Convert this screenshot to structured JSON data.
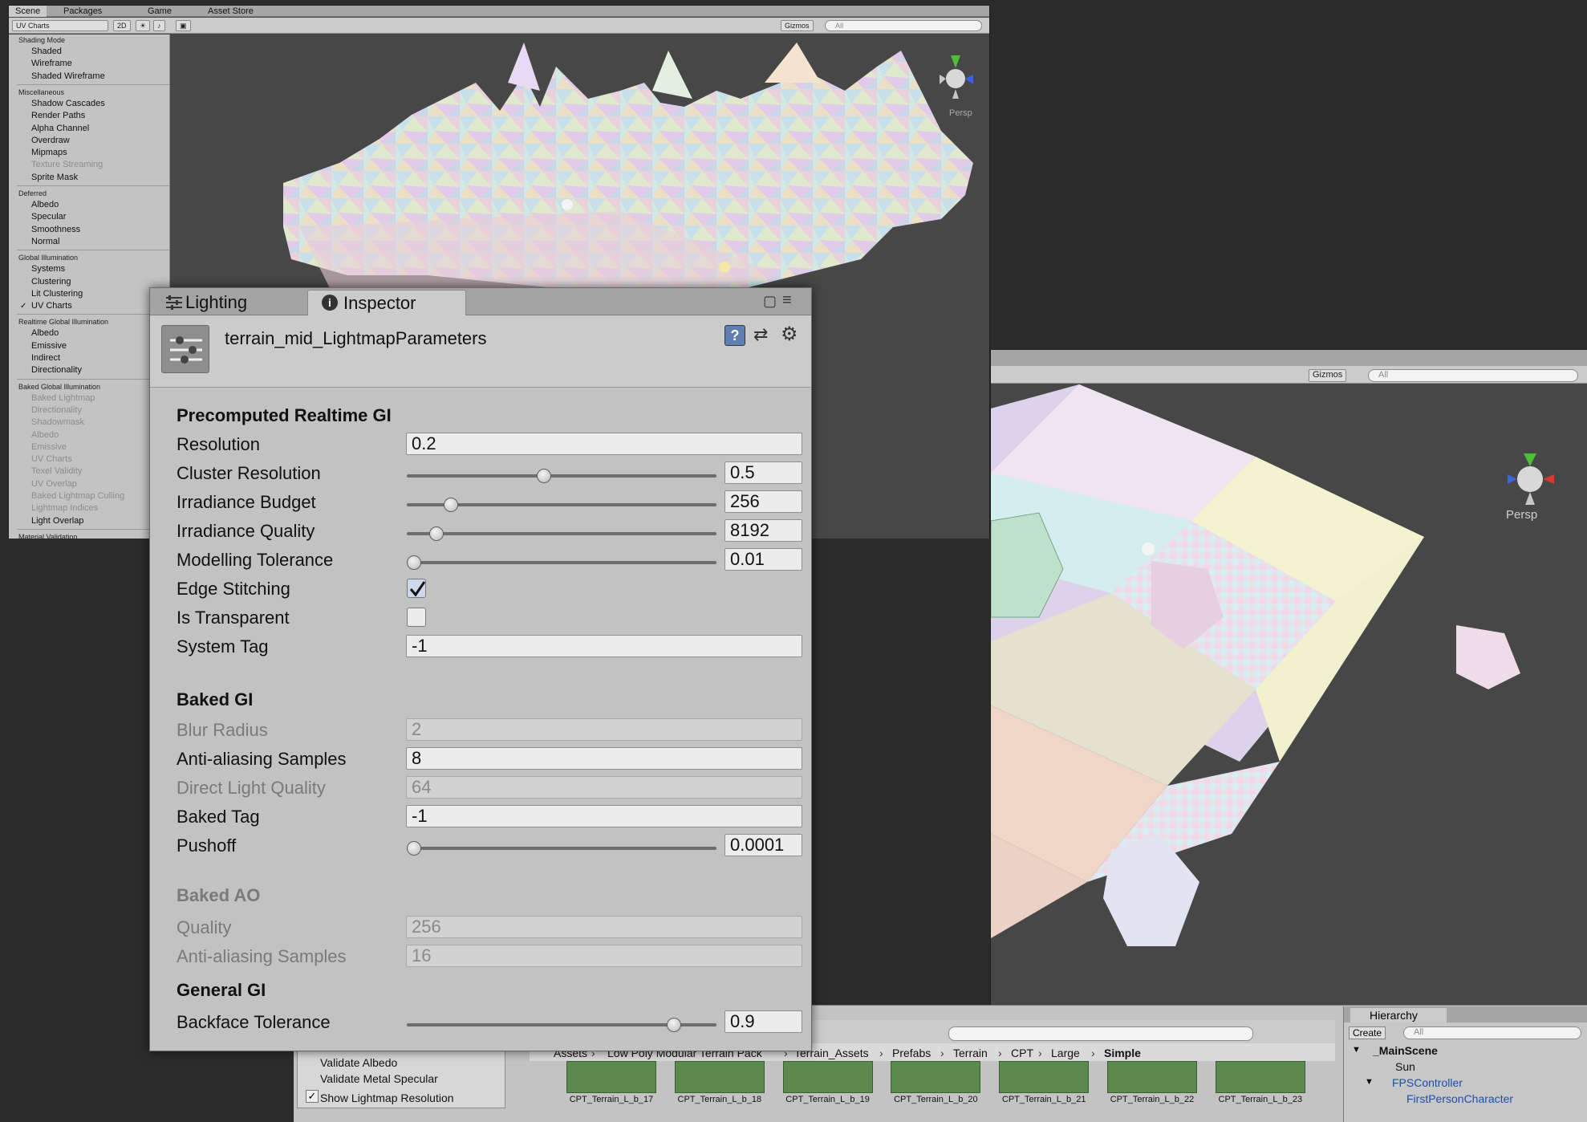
{
  "scene_window": {
    "tabs": [
      "Scene",
      "Packages",
      "Game",
      "Asset Store"
    ],
    "draw_mode": "UV Charts",
    "toolbar_2d": "2D",
    "gizmos": "Gizmos",
    "search_placeholder": "All",
    "persp": "Persp",
    "axes": [
      "y",
      "z",
      "x"
    ]
  },
  "view_menu": {
    "sections": [
      {
        "header": "Shading Mode",
        "items": [
          {
            "label": "Shaded",
            "dim": false
          },
          {
            "label": "Wireframe",
            "dim": false
          },
          {
            "label": "Shaded Wireframe",
            "dim": false
          }
        ]
      },
      {
        "header": "Miscellaneous",
        "items": [
          {
            "label": "Shadow Cascades",
            "dim": false
          },
          {
            "label": "Render Paths",
            "dim": false
          },
          {
            "label": "Alpha Channel",
            "dim": false
          },
          {
            "label": "Overdraw",
            "dim": false
          },
          {
            "label": "Mipmaps",
            "dim": false
          },
          {
            "label": "Texture Streaming",
            "dim": true
          },
          {
            "label": "Sprite Mask",
            "dim": false
          }
        ]
      },
      {
        "header": "Deferred",
        "items": [
          {
            "label": "Albedo",
            "dim": false
          },
          {
            "label": "Specular",
            "dim": false
          },
          {
            "label": "Smoothness",
            "dim": false
          },
          {
            "label": "Normal",
            "dim": false
          }
        ]
      },
      {
        "header": "Global Illumination",
        "items": [
          {
            "label": "Systems",
            "dim": false
          },
          {
            "label": "Clustering",
            "dim": false
          },
          {
            "label": "Lit Clustering",
            "dim": false
          },
          {
            "label": "UV Charts",
            "dim": false,
            "checked": true
          }
        ]
      },
      {
        "header": "Realtime Global Illumination",
        "items": [
          {
            "label": "Albedo",
            "dim": false
          },
          {
            "label": "Emissive",
            "dim": false
          },
          {
            "label": "Indirect",
            "dim": false
          },
          {
            "label": "Directionality",
            "dim": false
          }
        ]
      },
      {
        "header": "Baked Global Illumination",
        "items": [
          {
            "label": "Baked Lightmap",
            "dim": true
          },
          {
            "label": "Directionality",
            "dim": true
          },
          {
            "label": "Shadowmask",
            "dim": true
          },
          {
            "label": "Albedo",
            "dim": true
          },
          {
            "label": "Emissive",
            "dim": true
          },
          {
            "label": "UV Charts",
            "dim": true
          },
          {
            "label": "Texel Validity",
            "dim": true
          },
          {
            "label": "UV Overlap",
            "dim": true
          },
          {
            "label": "Baked Lightmap Culling",
            "dim": true
          },
          {
            "label": "Lightmap Indices",
            "dim": true
          },
          {
            "label": "Light Overlap",
            "dim": false
          }
        ]
      },
      {
        "header": "Material Validation",
        "items": []
      }
    ],
    "bottom_items": [
      "Validate Albedo",
      "Validate Metal Specular",
      "Show Lightmap Resolution"
    ]
  },
  "scene_window2": {
    "gizmos": "Gizmos",
    "search_placeholder": "All",
    "persp": "Persp",
    "tab_hierarchy": "Hierarchy"
  },
  "inspector": {
    "tabs": {
      "lighting": "Lighting",
      "inspector": "Inspector"
    },
    "asset_title": "terrain_mid_LightmapParameters",
    "precomputed": {
      "header": "Precomputed Realtime GI",
      "resolution_label": "Resolution",
      "resolution": "0.2",
      "cluster_label": "Cluster Resolution",
      "cluster": "0.5",
      "cluster_frac": 0.44,
      "budget_label": "Irradiance Budget",
      "budget": "256",
      "budget_frac": 0.125,
      "quality_label": "Irradiance Quality",
      "quality": "8192",
      "quality_frac": 0.075,
      "tolerance_label": "Modelling Tolerance",
      "tolerance": "0.01",
      "tolerance_frac": 0.0,
      "edge_label": "Edge Stitching",
      "edge": true,
      "transparent_label": "Is Transparent",
      "transparent": false,
      "systag_label": "System Tag",
      "systag": "-1"
    },
    "baked": {
      "header": "Baked GI",
      "blur_label": "Blur Radius",
      "blur": "2",
      "aa_label": "Anti-aliasing Samples",
      "aa": "8",
      "dlq_label": "Direct Light Quality",
      "dlq": "64",
      "tag_label": "Baked Tag",
      "tag": "-1",
      "pushoff_label": "Pushoff",
      "pushoff": "0.0001",
      "pushoff_frac": 0.0
    },
    "ao": {
      "header": "Baked AO",
      "quality_label": "Quality",
      "quality": "256",
      "aa_label": "Anti-aliasing Samples",
      "aa": "16"
    },
    "general": {
      "header": "General GI",
      "backface_label": "Backface Tolerance",
      "backface": "0.9",
      "backface_frac": 0.88
    }
  },
  "project": {
    "breadcrumb": [
      "Assets",
      "Low Poly Modular Terrain Pack",
      "Terrain_Assets",
      "Prefabs",
      "Terrain",
      "CPT",
      "Large",
      "Simple"
    ],
    "assets": [
      "CPT_Terrain_L_b_17",
      "CPT_Terrain_L_b_18",
      "CPT_Terrain_L_b_19",
      "CPT_Terrain_L_b_20",
      "CPT_Terrain_L_b_21",
      "CPT_Terrain_L_b_22",
      "CPT_Terrain_L_b_23"
    ]
  },
  "hierarchy": {
    "title": "Hierarchy",
    "create": "Create",
    "search_placeholder": "All",
    "items": [
      "_MainScene",
      "Sun",
      "FPSController",
      "FirstPersonCharacter"
    ]
  },
  "colors": {
    "accent_blue": "#1f4fa8",
    "panel": "#c2c2c2",
    "scene_bg": "#474747"
  }
}
